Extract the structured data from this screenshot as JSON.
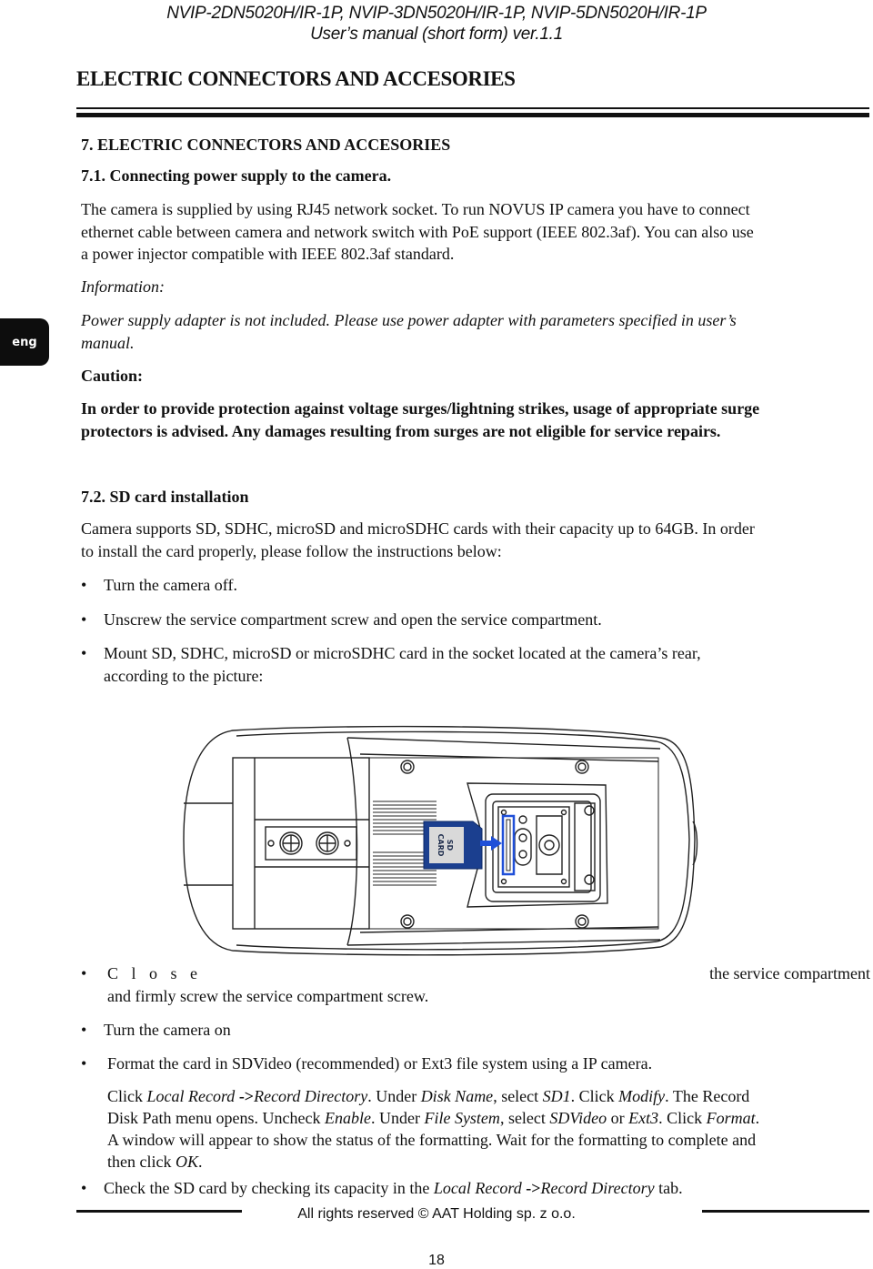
{
  "header": {
    "models": "NVIP-2DN5020H/IR-1P, NVIP-3DN5020H/IR-1P, NVIP-5DN5020H/IR-1P",
    "manual": "User’s manual (short form) ver.1.1"
  },
  "chapter_title": "ELECTRIC CONNECTORS AND ACCESORIES",
  "language_tab": "eng",
  "section7": {
    "title": "7. ELECTRIC CONNECTORS AND ACCESORIES",
    "sub1": {
      "title": "7.1. Connecting  power supply to the camera.",
      "paragraph": [
        "The camera is supplied by using RJ45 network socket. To run NOVUS IP camera you have to connect",
        "ethernet cable between camera and network switch with PoE support  (IEEE 802.3af). You can also use",
        "a power injector  compatible with IEEE 802.3af standard."
      ],
      "info_label": "Information:",
      "info_text": [
        "Power supply adapter is not included. Please use power adapter with parameters specified in user’s",
        "manual."
      ],
      "caution_label": "Caution:",
      "caution_text": [
        "In order to provide protection against voltage surges/lightning strikes, usage of appropriate surge",
        "protectors is advised. Any damages resulting from surges are not eligible for service repairs."
      ]
    },
    "sub2": {
      "title": "7.2. SD card installation",
      "paragraph": [
        "Camera supports SD, SDHC, microSD and microSDHC cards with their capacity up to 64GB. In order",
        "to install the card properly, please follow the instructions below:"
      ],
      "steps_before": [
        "Turn the camera off.",
        "Unscrew the service compartment screw and open the service compartment.",
        [
          "Mount SD, SDHC, microSD or microSDHC card in the socket located at the camera’s rear,",
          "according to the picture:"
        ]
      ],
      "figure": {
        "sd_card_label_1": "SD",
        "sd_card_label_2": "CARD",
        "colors": {
          "card": "#1b3f8f",
          "card_label_bg": "#d9d9d9",
          "slot_highlight": "#1f4fd8",
          "arrow": "#1f4fd8"
        }
      },
      "step_close": {
        "first_word": "C l o s e",
        "first_line_end": "the service compartment",
        "second_line": "and firmly screw the service compartment screw."
      },
      "step_on": "Turn the camera on",
      "step_format": "Format the card in SDVideo (recommended) or Ext3 file system using a IP camera.",
      "format_details": {
        "line1": [
          {
            "t": "Click ",
            "i": false
          },
          {
            "t": "Local Record ",
            "i": true
          },
          {
            "t": "->",
            "i": false,
            "b": true
          },
          {
            "t": "Record Directory",
            "i": true
          },
          {
            "t": ". Under ",
            "i": false
          },
          {
            "t": "Disk Name",
            "i": true
          },
          {
            "t": ", select ",
            "i": false
          },
          {
            "t": "SD1",
            "i": true
          },
          {
            "t": ". Click ",
            "i": false
          },
          {
            "t": "Modify",
            "i": true
          },
          {
            "t": ". The Record",
            "i": false
          }
        ],
        "line2": [
          {
            "t": "Disk Path menu opens. Uncheck ",
            "i": false
          },
          {
            "t": "Enable",
            "i": true
          },
          {
            "t": ". Under ",
            "i": false
          },
          {
            "t": "File System",
            "i": true
          },
          {
            "t": ", select ",
            "i": false
          },
          {
            "t": "SDVideo",
            "i": true
          },
          {
            "t": " or ",
            "i": false
          },
          {
            "t": "Ext3",
            "i": true
          },
          {
            "t": ". Click ",
            "i": false
          },
          {
            "t": "Format",
            "i": true
          },
          {
            "t": ".",
            "i": false
          }
        ],
        "line3": [
          {
            "t": "A window will appear to show the status of the formatting. Wait for the formatting to complete and",
            "i": false
          }
        ],
        "line4": [
          {
            "t": "then click ",
            "i": false
          },
          {
            "t": "OK",
            "i": true
          },
          {
            "t": ".",
            "i": false
          }
        ]
      },
      "step_check": [
        {
          "t": "Check the SD card by checking its capacity in the ",
          "i": false
        },
        {
          "t": "Local Record ",
          "i": true
        },
        {
          "t": "->",
          "i": false,
          "b": true
        },
        {
          "t": "Record Directory",
          "i": true
        },
        {
          "t": " tab.",
          "i": false
        }
      ]
    }
  },
  "footer": {
    "copyright": "All rights reserved ©  AAT Holding sp. z o.o.",
    "page_number": "18"
  }
}
